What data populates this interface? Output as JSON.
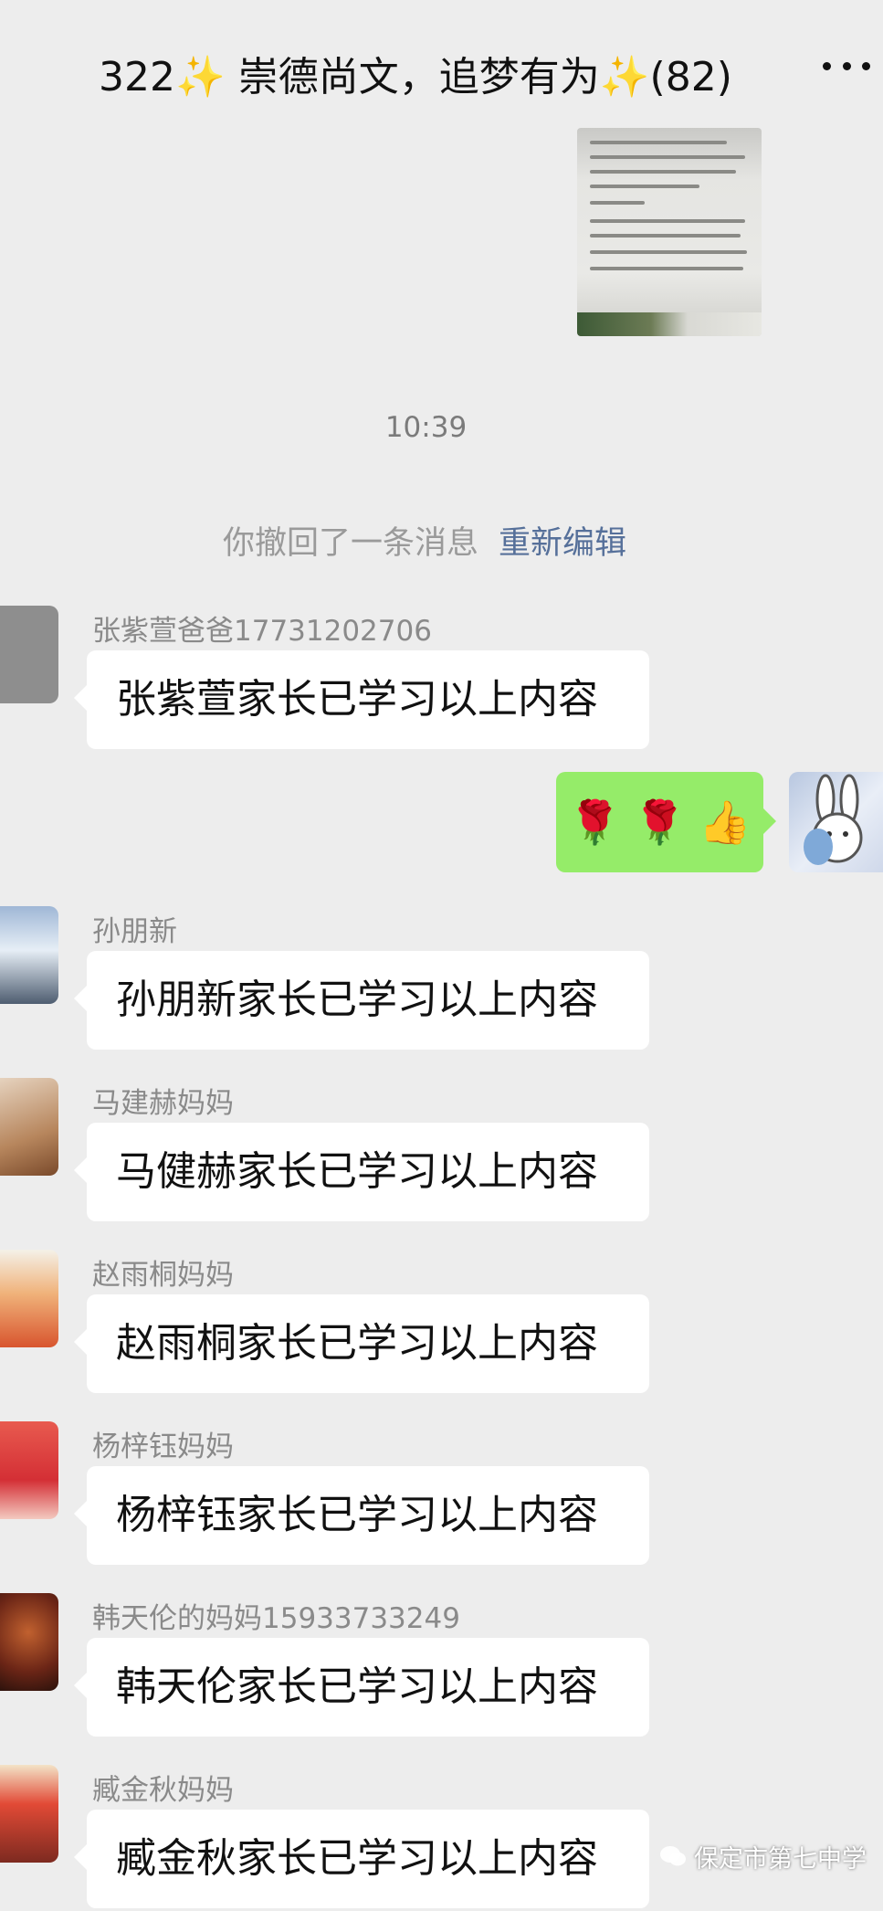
{
  "header": {
    "title": "322✨ 崇德尚文，追梦有为✨(82)",
    "more_icon": "more-icon"
  },
  "chat": {
    "time": "10:39",
    "recall_text": "你撤回了一条消息",
    "recall_edit_label": "重新编辑",
    "self_reply": {
      "emojis": [
        "🌹",
        "🌹",
        "👍"
      ]
    },
    "messages": [
      {
        "sender": "张紫萱爸爸17731202706",
        "text": "张紫萱家长已学习以上内容",
        "avatar_color": "#8e8e8e"
      },
      {
        "sender": "孙朋新",
        "text": "孙朋新家长已学习以上内容",
        "avatar_color": "#6f8fb5"
      },
      {
        "sender": "马建赫妈妈",
        "text": "马健赫家长已学习以上内容",
        "avatar_color": "#c79a77"
      },
      {
        "sender": "赵雨桐妈妈",
        "text": "赵雨桐家长已学习以上内容",
        "avatar_color": "#e07a3c"
      },
      {
        "sender": "杨梓钰妈妈",
        "text": "杨梓钰家长已学习以上内容",
        "avatar_color": "#d9343a"
      },
      {
        "sender": "韩天伦的妈妈15933733249",
        "text": "韩天伦家长已学习以上内容",
        "avatar_color": "#7a2b1c"
      },
      {
        "sender": "臧金秋妈妈",
        "text": "臧金秋家长已学习以上内容",
        "avatar_color": "#c23a2e"
      }
    ]
  },
  "watermark": {
    "text": "保定市第七中学"
  }
}
